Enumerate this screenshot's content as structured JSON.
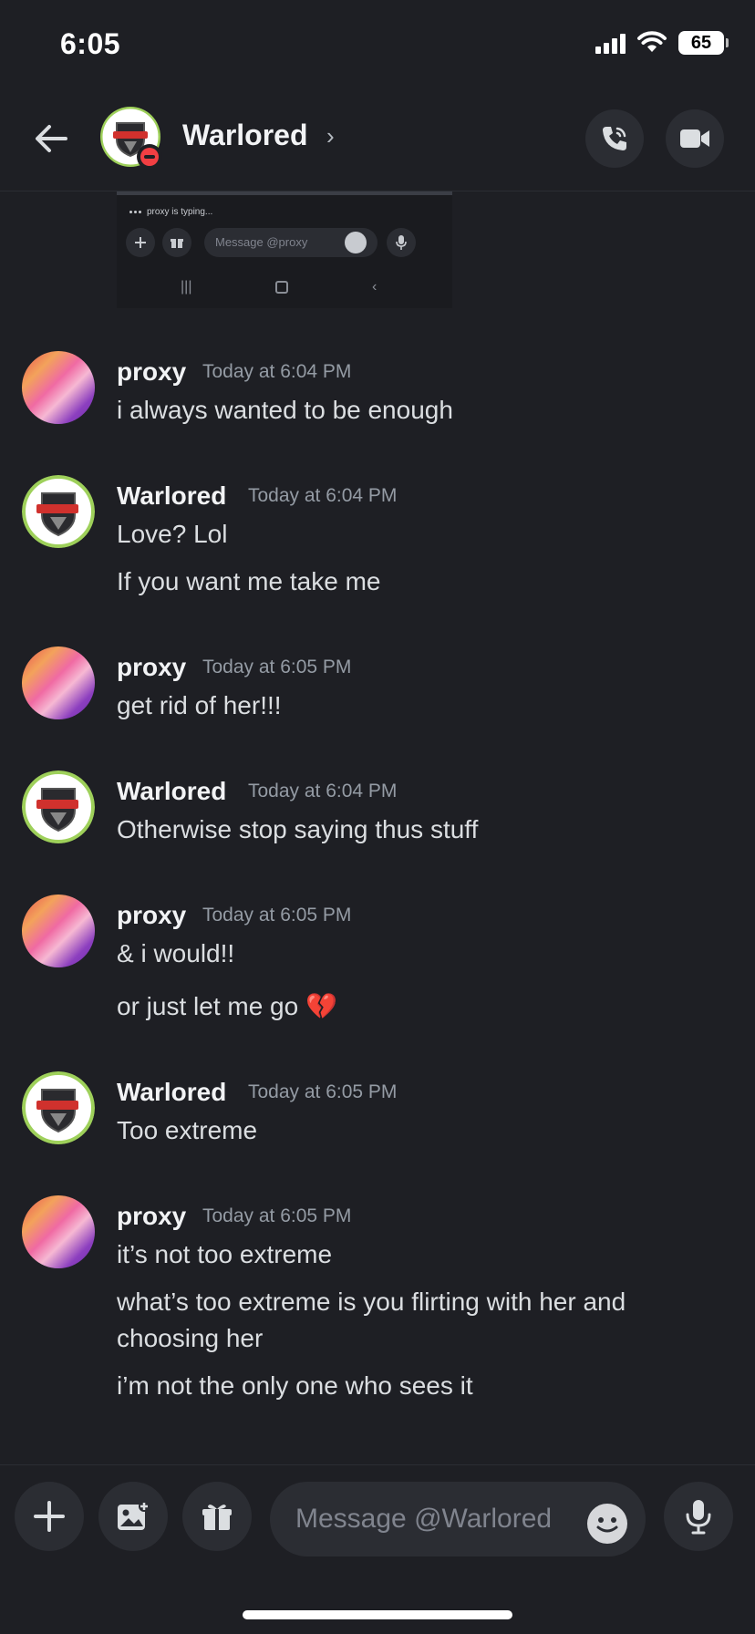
{
  "status_bar": {
    "time": "6:05",
    "battery": "65"
  },
  "header": {
    "name": "Warlored",
    "chevron": "›",
    "icons": [
      "back-arrow-icon",
      "call-icon",
      "video-icon"
    ]
  },
  "embed": {
    "typing_text": "proxy is typing...",
    "input_placeholder": "Message @proxy"
  },
  "messages": [
    {
      "author": "proxy",
      "timestamp": "Today at 6:04 PM",
      "lines": [
        "i always wanted to be enough"
      ]
    },
    {
      "author": "Warlored",
      "timestamp": "Today at 6:04 PM",
      "lines": [
        "Love? Lol",
        "If you want me take me"
      ]
    },
    {
      "author": "proxy",
      "timestamp": "Today at 6:05 PM",
      "lines": [
        "get rid of her!!!"
      ]
    },
    {
      "author": "Warlored",
      "timestamp": "Today at 6:04 PM",
      "lines": [
        "Otherwise stop saying thus stuff"
      ]
    },
    {
      "author": "proxy",
      "timestamp": "Today at 6:05 PM",
      "lines": [
        "& i would!!",
        "or just let me go 💔"
      ]
    },
    {
      "author": "Warlored",
      "timestamp": "Today at 6:05 PM",
      "lines": [
        "Too extreme"
      ]
    },
    {
      "author": "proxy",
      "timestamp": "Today at 6:05 PM",
      "lines": [
        "it’s not too extreme",
        "what’s too extreme is you flirting with her and choosing her",
        "i’m not the only one who sees it"
      ]
    }
  ],
  "composer": {
    "placeholder": "Message @Warlored"
  },
  "colors": {
    "background": "#1e1f24",
    "button_bg": "#2b2d33",
    "dnd_red": "#f23f43",
    "timestamp_gray": "#949ba4",
    "avatar_ring_green": "#9ed05a"
  }
}
